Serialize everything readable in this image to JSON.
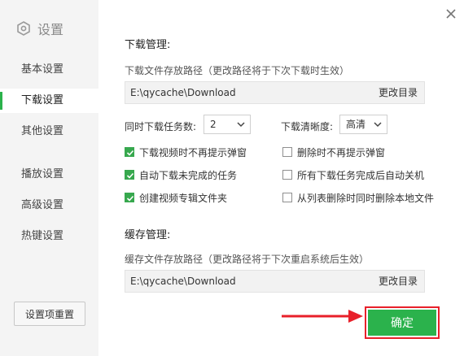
{
  "sidebar": {
    "title": "设置",
    "items": [
      {
        "label": "基本设置",
        "active": false
      },
      {
        "label": "下载设置",
        "active": true
      },
      {
        "label": "其他设置",
        "active": false
      },
      {
        "label": "播放设置",
        "active": false
      },
      {
        "label": "高级设置",
        "active": false
      },
      {
        "label": "热键设置",
        "active": false
      }
    ],
    "reset_label": "设置项重置"
  },
  "download": {
    "title": "下载管理:",
    "path_hint": "下载文件存放路径（更改路径将于下次下载时生效）",
    "path": "E:\\qycache\\Download",
    "change_dir": "更改目录",
    "concurrent_label": "同时下载任务数:",
    "concurrent_value": "2",
    "quality_label": "下载清晰度:",
    "quality_value": "高清",
    "options": [
      {
        "label": "下载视频时不再提示弹窗",
        "checked": true
      },
      {
        "label": "删除时不再提示弹窗",
        "checked": false
      },
      {
        "label": "自动下载未完成的任务",
        "checked": true
      },
      {
        "label": "所有下载任务完成后自动关机",
        "checked": false
      },
      {
        "label": "创建视频专辑文件夹",
        "checked": true
      },
      {
        "label": "从列表删除时同时删除本地文件",
        "checked": false
      }
    ]
  },
  "cache": {
    "title": "缓存管理:",
    "path_hint": "缓存文件存放路径（更改路径将于下次重启系统后生效）",
    "path": "E:\\qycache\\Download",
    "change_dir": "更改目录"
  },
  "footer": {
    "confirm_label": "确定"
  },
  "colors": {
    "accent": "#2bb24c",
    "highlight_frame": "#e8202a",
    "sidebar_bg": "#f4f4f4"
  }
}
